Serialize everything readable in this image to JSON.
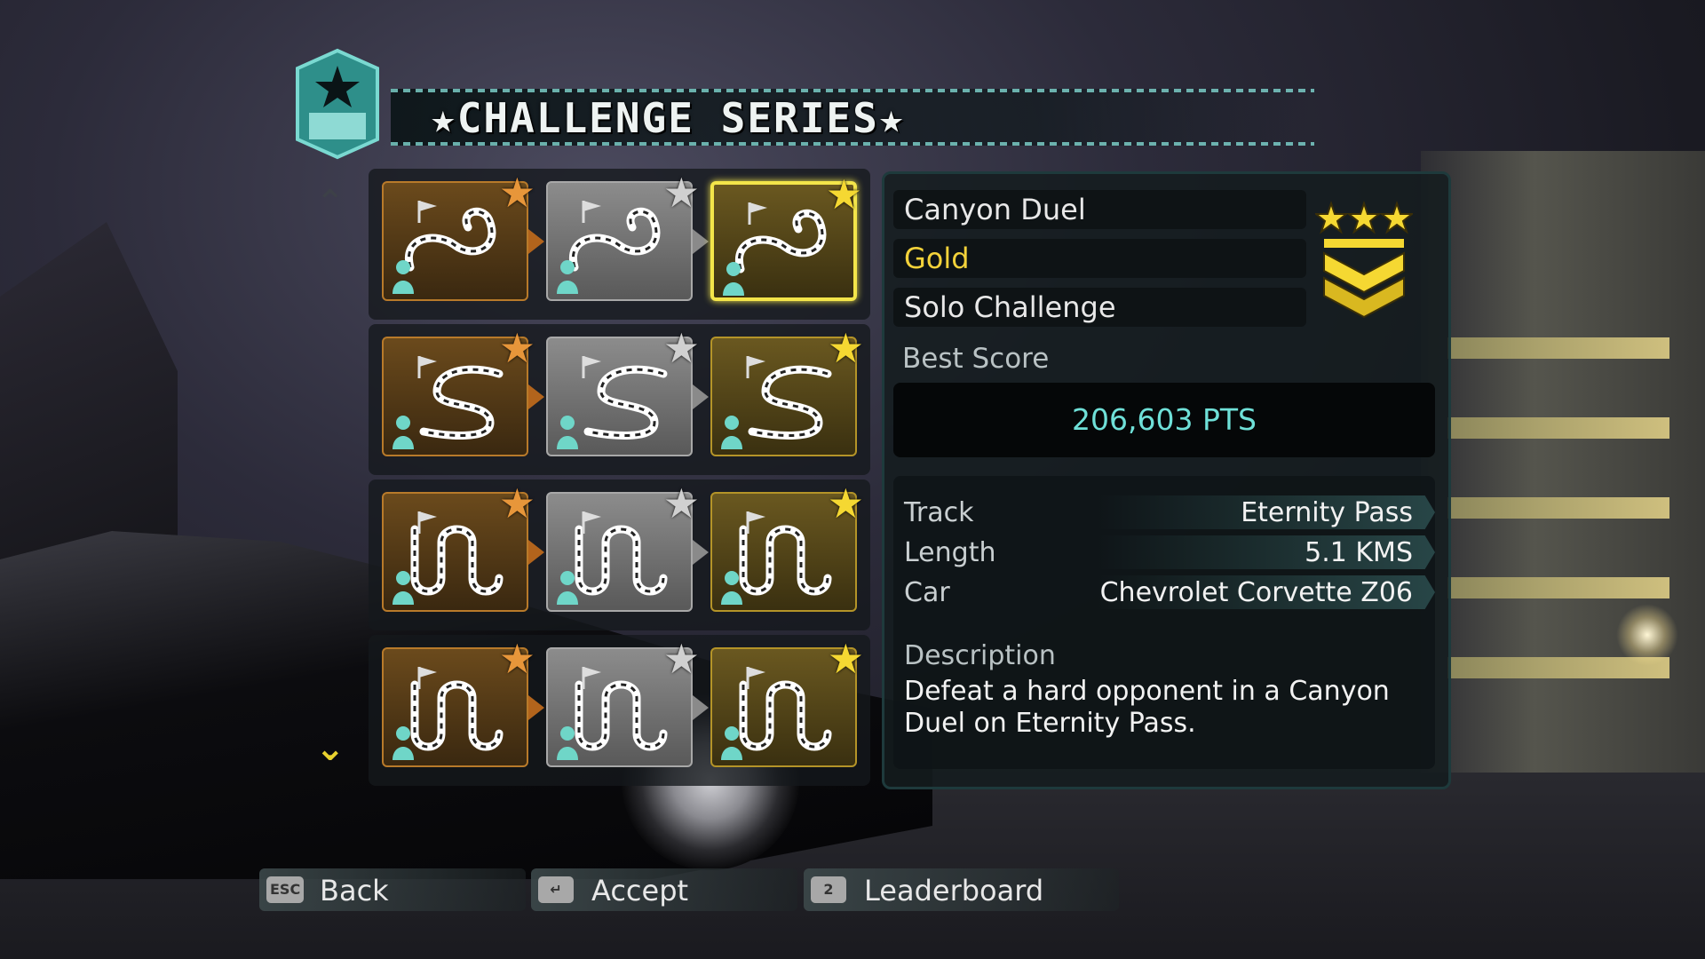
{
  "header": {
    "title": "★CHALLENGE SERIES★"
  },
  "grid": {
    "rows": [
      {
        "track_type": "canyon-duel-icon",
        "tiles": [
          {
            "medal": "bronze",
            "state": "normal"
          },
          {
            "medal": "silver",
            "state": "normal"
          },
          {
            "medal": "gold",
            "state": "selected"
          }
        ]
      },
      {
        "track_type": "canyon-race-icon",
        "tiles": [
          {
            "medal": "bronze",
            "state": "normal"
          },
          {
            "medal": "silver",
            "state": "normal"
          },
          {
            "medal": "gold",
            "state": "normal"
          }
        ]
      },
      {
        "track_type": "sprint-icon",
        "tiles": [
          {
            "medal": "bronze",
            "state": "normal"
          },
          {
            "medal": "silver",
            "state": "normal"
          },
          {
            "medal": "gold",
            "state": "normal"
          }
        ]
      },
      {
        "track_type": "sprint-icon",
        "tiles": [
          {
            "medal": "bronze",
            "state": "normal"
          },
          {
            "medal": "silver",
            "state": "normal"
          },
          {
            "medal": "gold",
            "state": "normal"
          }
        ]
      }
    ]
  },
  "details": {
    "event_name": "Canyon Duel",
    "medal": "Gold",
    "mode": "Solo Challenge",
    "stars": 3,
    "best_score_label": "Best Score",
    "best_score": "206,603 PTS",
    "info": [
      {
        "key": "Track",
        "value": "Eternity Pass"
      },
      {
        "key": "Length",
        "value": "5.1 KMS"
      },
      {
        "key": "Car",
        "value": "Chevrolet Corvette Z06"
      }
    ],
    "description_label": "Description",
    "description": "Defeat a hard opponent in a Canyon Duel on Eternity Pass."
  },
  "buttons": [
    {
      "key": "ESC",
      "label": "Back"
    },
    {
      "key": "↵",
      "label": "Accept"
    },
    {
      "key": "2",
      "label": "Leaderboard"
    }
  ],
  "colors": {
    "accent_teal": "#6fe0d8",
    "gold": "#f3d23a",
    "bronze": "#e7963a",
    "silver": "#d0d0d0",
    "selection": "#f3e54a"
  }
}
